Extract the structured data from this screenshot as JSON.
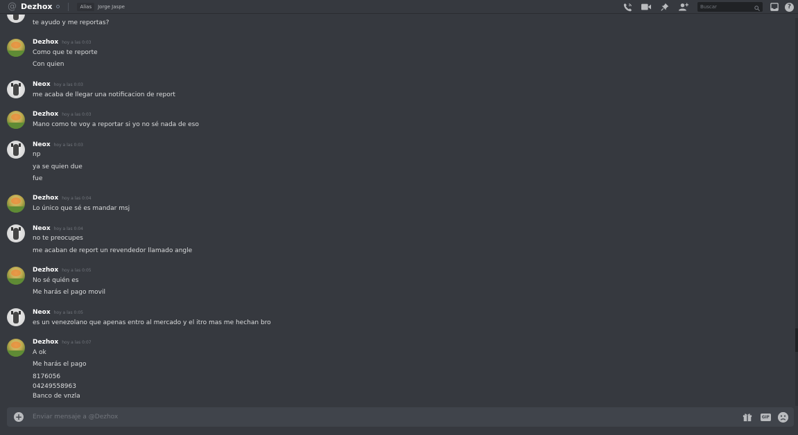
{
  "header": {
    "title": "Dezhox",
    "alias_label": "Alias",
    "alias_name": "Jorge Jaspe",
    "search_placeholder": "Buscar",
    "icons": [
      "at-icon",
      "phone-call-icon",
      "video-icon",
      "pin-icon",
      "add-friend-icon",
      "search-icon",
      "inbox-icon",
      "help-icon"
    ]
  },
  "messages": [
    {
      "text": "te ayudo y me reportas?"
    },
    {
      "author": "Dezhox",
      "time": "hoy a las 0:03",
      "lines": [
        "Como que te reporte",
        "Con quien"
      ]
    },
    {
      "author": "Neox",
      "time": "hoy a las 0:03",
      "lines": [
        "me acaba de llegar una notificacion de report"
      ]
    },
    {
      "author": "Dezhox",
      "time": "hoy a las 0:03",
      "lines": [
        "Mano como te voy a reportar si yo no sé nada de eso"
      ]
    },
    {
      "author": "Neox",
      "time": "hoy a las 0:03",
      "lines": [
        "np",
        "ya se quien due",
        "fue"
      ]
    },
    {
      "author": "Dezhox",
      "time": "hoy a las 0:04",
      "lines": [
        "Lo único que sé es mandar msj"
      ]
    },
    {
      "author": "Neox",
      "time": "hoy a las 0:04",
      "lines": [
        "no te preocupes",
        "me acaban de report un revendedor llamado angle"
      ]
    },
    {
      "author": "Dezhox",
      "time": "hoy a las 0:05",
      "lines": [
        "No sé quién es",
        "Me harás el pago movil"
      ]
    },
    {
      "author": "Neox",
      "time": "hoy a las 0:05",
      "lines": [
        "es un venezolano que apenas entro al mercado y el itro mas me hechan bro"
      ]
    },
    {
      "author": "Dezhox",
      "time": "hoy a las 0:07",
      "lines": [
        "A ok",
        "Me harás el pago",
        "8176056",
        "04249558963",
        "Banco de vnzla"
      ]
    }
  ],
  "composer": {
    "placeholder": "Enviar mensaje a @Dezhox",
    "gif_label": "GIF"
  },
  "colors": {
    "background": "#36393f",
    "composer": "#40444b",
    "author": "#ffffff",
    "text": "#dcddde",
    "timestamp": "#72767d"
  }
}
